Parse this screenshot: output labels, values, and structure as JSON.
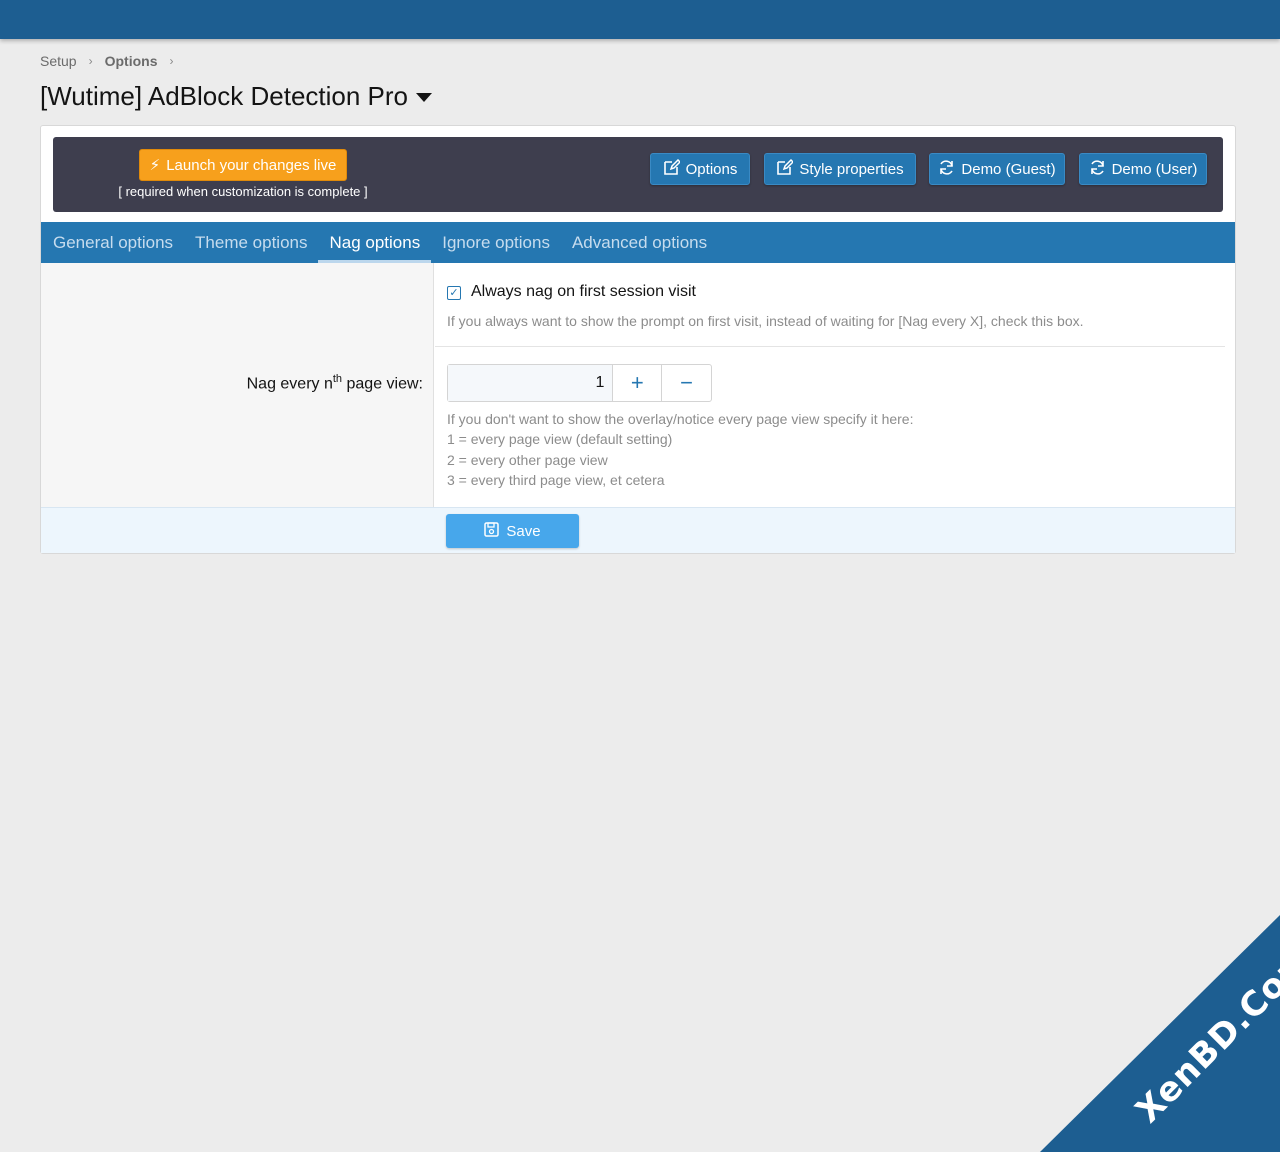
{
  "breadcrumb": [
    {
      "label": "Setup"
    },
    {
      "label": "Options"
    }
  ],
  "page": {
    "title": "[Wutime] AdBlock Detection Pro"
  },
  "toolbar": {
    "launch_label": "Launch your changes live",
    "launch_note": "[ required when customization is complete ]",
    "buttons": [
      {
        "label": "Options",
        "icon": "edit-icon"
      },
      {
        "label": "Style properties",
        "icon": "edit-icon"
      },
      {
        "label": "Demo (Guest)",
        "icon": "refresh-icon"
      },
      {
        "label": "Demo (User)",
        "icon": "refresh-icon"
      }
    ]
  },
  "tabs": [
    {
      "label": "General options",
      "active": false
    },
    {
      "label": "Theme options",
      "active": false
    },
    {
      "label": "Nag options",
      "active": true
    },
    {
      "label": "Ignore options",
      "active": false
    },
    {
      "label": "Advanced options",
      "active": false
    }
  ],
  "form": {
    "always_nag": {
      "label": "Always nag on first session visit",
      "checked": true,
      "hint": "If you always want to show the prompt on first visit, instead of waiting for [Nag every X], check this box."
    },
    "nag_every": {
      "label_pre": "Nag every n",
      "label_sup": "th",
      "label_post": " page view:",
      "value": "1",
      "hint_lines": [
        "If you don't want to show the overlay/notice every page view specify it here:",
        "1 = every page view (default setting)",
        "2 = every other page view",
        "3 = every third page view, et cetera"
      ]
    }
  },
  "footer": {
    "save_label": "Save"
  },
  "watermark": {
    "text": "XenBD.Com"
  },
  "colors": {
    "brand": "#1d5e91",
    "tab_bar": "#2577b1",
    "launch": "#f7a01c",
    "save": "#47a7eb"
  }
}
